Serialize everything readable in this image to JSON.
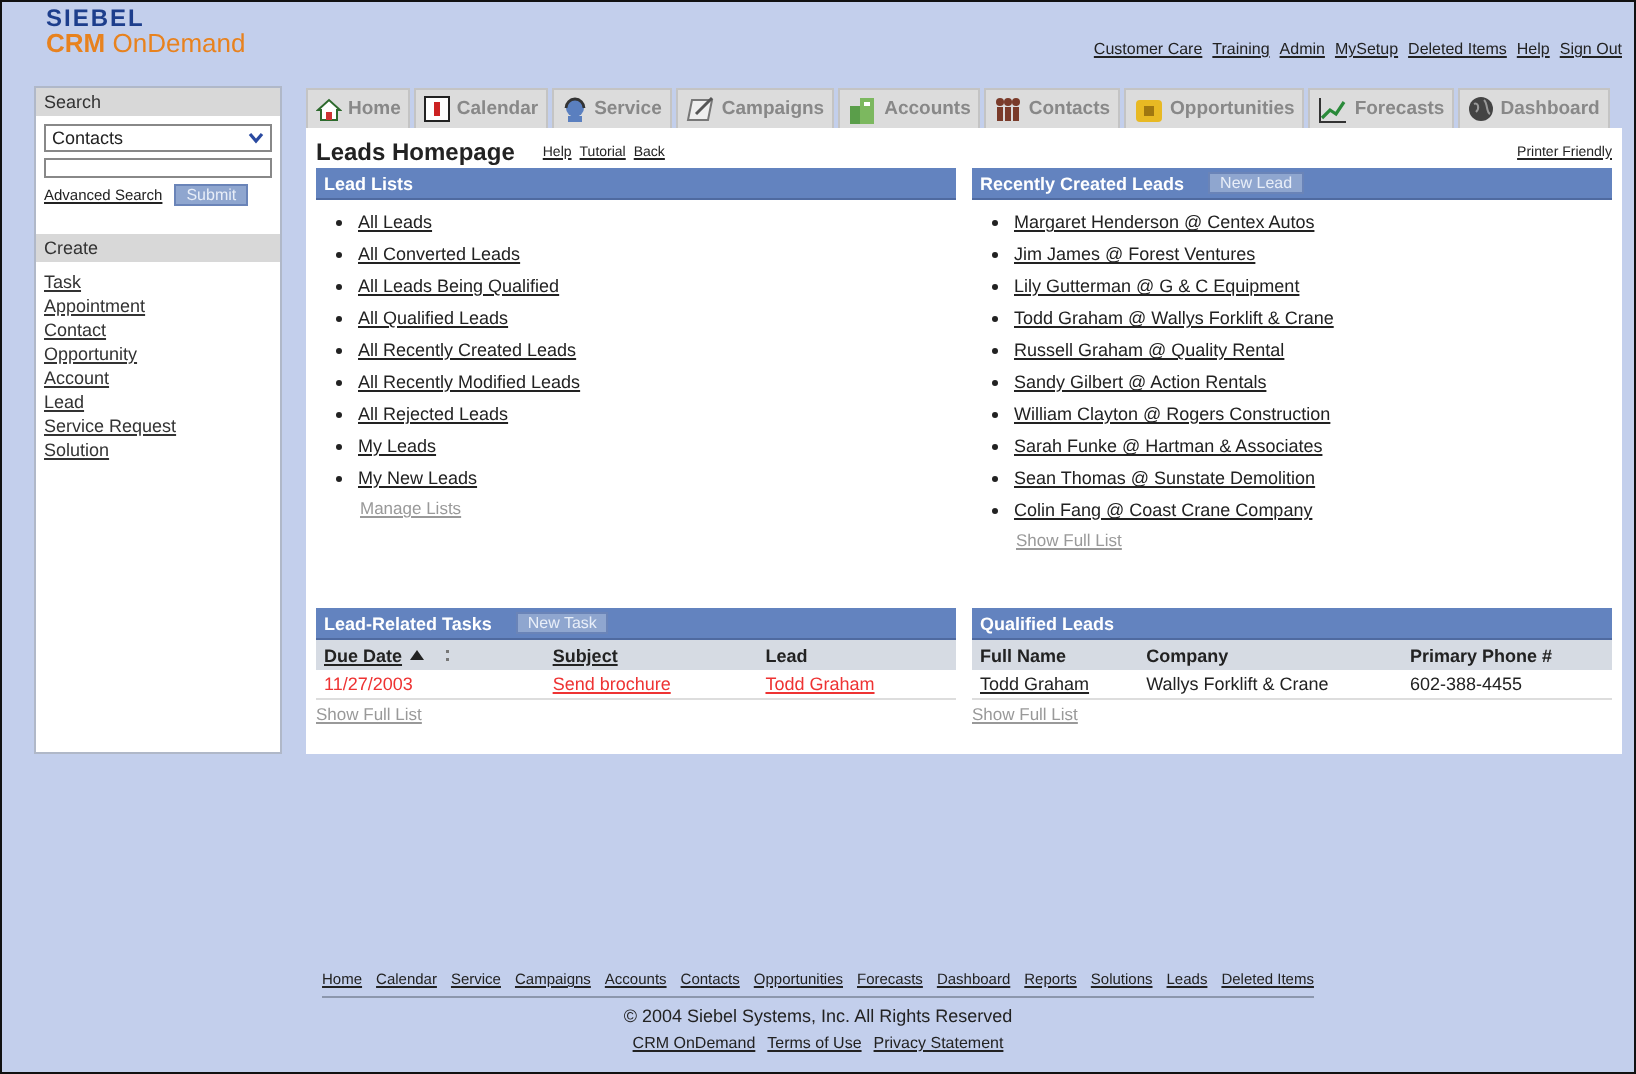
{
  "logo": {
    "brand": "SIEBEL",
    "product_bold": "CRM",
    "product": "OnDemand"
  },
  "top_links": [
    "Customer Care",
    "Training",
    "Admin",
    "MySetup",
    "Deleted Items",
    "Help",
    "Sign Out"
  ],
  "sidebar": {
    "search": {
      "title": "Search",
      "select_value": "Contacts",
      "advanced_link": "Advanced Search",
      "submit": "Submit"
    },
    "create": {
      "title": "Create",
      "items": [
        "Task",
        "Appointment",
        "Contact",
        "Opportunity",
        "Account",
        "Lead",
        "Service Request",
        "Solution"
      ]
    }
  },
  "tabs": [
    {
      "label": "Home",
      "selected": false
    },
    {
      "label": "Calendar",
      "selected": false
    },
    {
      "label": "Service",
      "selected": false
    },
    {
      "label": "Campaigns",
      "selected": false
    },
    {
      "label": "Accounts",
      "selected": false
    },
    {
      "label": "Contacts",
      "selected": false
    },
    {
      "label": "Opportunities",
      "selected": false
    },
    {
      "label": "Forecasts",
      "selected": false
    },
    {
      "label": "Dashboard",
      "selected": false
    }
  ],
  "page": {
    "title": "Leads Homepage",
    "links": [
      "Help",
      "Tutorial",
      "Back"
    ],
    "printer_link": "Printer Friendly"
  },
  "lead_lists": {
    "title": "Lead Lists",
    "items": [
      "All Leads",
      "All Converted Leads",
      "All Leads Being Qualified",
      "All Qualified Leads",
      "All Recently Created Leads",
      "All Recently Modified Leads",
      "All Rejected Leads",
      "My Leads",
      "My New Leads"
    ],
    "footer_link": "Manage Lists"
  },
  "recent_leads": {
    "title": "Recently Created Leads",
    "button": "New Lead",
    "items": [
      "Margaret Henderson @ Centex Autos",
      "Jim James @ Forest Ventures",
      "Lily Gutterman @ G & C Equipment",
      "Todd Graham @ Wallys Forklift & Crane",
      "Russell Graham @ Quality Rental",
      "Sandy Gilbert @ Action Rentals",
      "William Clayton @ Rogers Construction",
      "Sarah Funke @ Hartman & Associates",
      "Sean Thomas @ Sunstate Demolition",
      "Colin Fang @ Coast Crane Company"
    ],
    "footer_link": "Show Full List"
  },
  "tasks": {
    "title": "Lead-Related Tasks",
    "button": "New Task",
    "columns": [
      "Due Date",
      "Subject",
      "Lead"
    ],
    "rows": [
      {
        "due": "11/27/2003",
        "subject": "Send brochure",
        "lead": "Todd Graham",
        "overdue": true
      }
    ],
    "footer_link": "Show Full List"
  },
  "qualified": {
    "title": "Qualified Leads",
    "columns": [
      "Full Name",
      "Company",
      "Primary Phone #"
    ],
    "rows": [
      {
        "name": "Todd Graham",
        "company": "Wallys Forklift & Crane",
        "phone": "602-388-4455"
      }
    ],
    "footer_link": "Show Full List"
  },
  "footer": {
    "links": [
      "Home",
      "Calendar",
      "Service",
      "Campaigns",
      "Accounts",
      "Contacts",
      "Opportunities",
      "Forecasts",
      "Dashboard",
      "Reports",
      "Solutions",
      "Leads",
      "Deleted Items"
    ],
    "copyright": "© 2004 Siebel Systems, Inc. All Rights Reserved",
    "bottom_links": [
      "CRM OnDemand",
      "Terms of Use",
      "Privacy Statement"
    ]
  }
}
